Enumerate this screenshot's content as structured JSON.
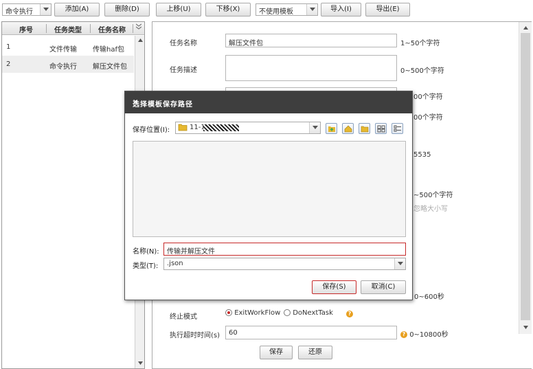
{
  "toolbar": {
    "mode_select": "命令执行",
    "add": "添加(A)",
    "delete": "删除(D)",
    "move_up": "上移(U)",
    "move_down": "下移(X)",
    "template_select": "不使用模板",
    "import": "导入(I)",
    "export": "导出(E)"
  },
  "task_list": {
    "columns": [
      "序号",
      "任务类型",
      "任务名称"
    ],
    "rows": [
      [
        "1",
        "文件传输",
        "传输haf包"
      ],
      [
        "2",
        "命令执行",
        "解压文件包"
      ]
    ]
  },
  "form": {
    "task_name_label": "任务名称",
    "task_name_value": "解压文件包",
    "task_name_hint": "1~50个字符",
    "task_desc_label": "任务描述",
    "task_desc_hint": "0~500个字符",
    "hint_3": "00个字符",
    "hint_4": "00个字符",
    "hint_5": "5535",
    "hint_6": "~500个字符",
    "hint_7": "忽略大小写",
    "hint_8": "0~600秒",
    "stop_mode_label": "终止模式",
    "stop_mode_options": [
      "ExitWorkFlow",
      "DoNextTask"
    ],
    "timeout_label": "执行超时时间(s)",
    "timeout_value": "60",
    "timeout_hint": "0~10800秒",
    "save_button": "保存",
    "restore_button": "还原"
  },
  "modal": {
    "title": "选择模板保存路径",
    "close": "×",
    "location_label": "保存位置(I):",
    "location_value": "11-1",
    "name_label": "名称(N):",
    "name_value": "传输并解压文件",
    "type_label": "类型(T):",
    "type_value": ".json",
    "save_button": "保存(S)",
    "cancel_button": "取消(C)"
  },
  "colors": {
    "modal_title_bg": "#3e3e3e",
    "accent_red": "#c62828",
    "help_icon": "#e8a020",
    "folder_icon": "#e6b830"
  }
}
